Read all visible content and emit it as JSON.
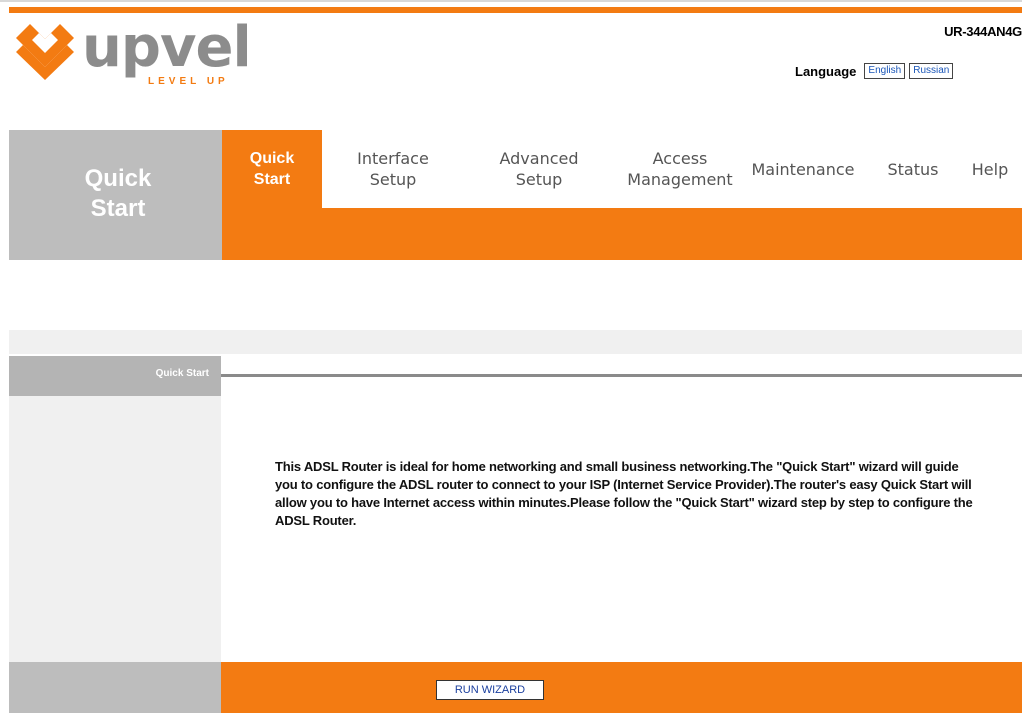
{
  "brand": {
    "name": "upvel",
    "tagline": "LEVEL UP",
    "model": "UR-344AN4G",
    "colors": {
      "accent": "#f37b12",
      "logo_gray": "#8c8c8c",
      "sidebar_gray": "#bdbdbd"
    }
  },
  "language": {
    "label": "Language",
    "options": [
      "English",
      "Russian"
    ]
  },
  "nav": {
    "section_title": "Quick Start",
    "tabs": [
      {
        "label": "Quick Start",
        "lines": [
          "Quick",
          "Start"
        ],
        "active": true
      },
      {
        "label": "Interface Setup",
        "lines": [
          "Interface",
          "Setup"
        ],
        "active": false
      },
      {
        "label": "Advanced Setup",
        "lines": [
          "Advanced",
          "Setup"
        ],
        "active": false
      },
      {
        "label": "Access Management",
        "lines": [
          "Access",
          "Management"
        ],
        "active": false
      },
      {
        "label": "Maintenance",
        "active": false
      },
      {
        "label": "Status",
        "active": false
      },
      {
        "label": "Help",
        "active": false
      }
    ]
  },
  "content": {
    "side_header": "Quick Start",
    "description": "This ADSL Router is ideal for home networking and small business networking.The \"Quick Start\" wizard will guide you to configure the ADSL router to connect to your ISP (Internet Service Provider).The router's easy Quick Start will allow you to have Internet access within minutes.Please follow the \"Quick Start\" wizard step by step to configure the ADSL Router.",
    "run_wizard_label": "RUN WIZARD"
  }
}
